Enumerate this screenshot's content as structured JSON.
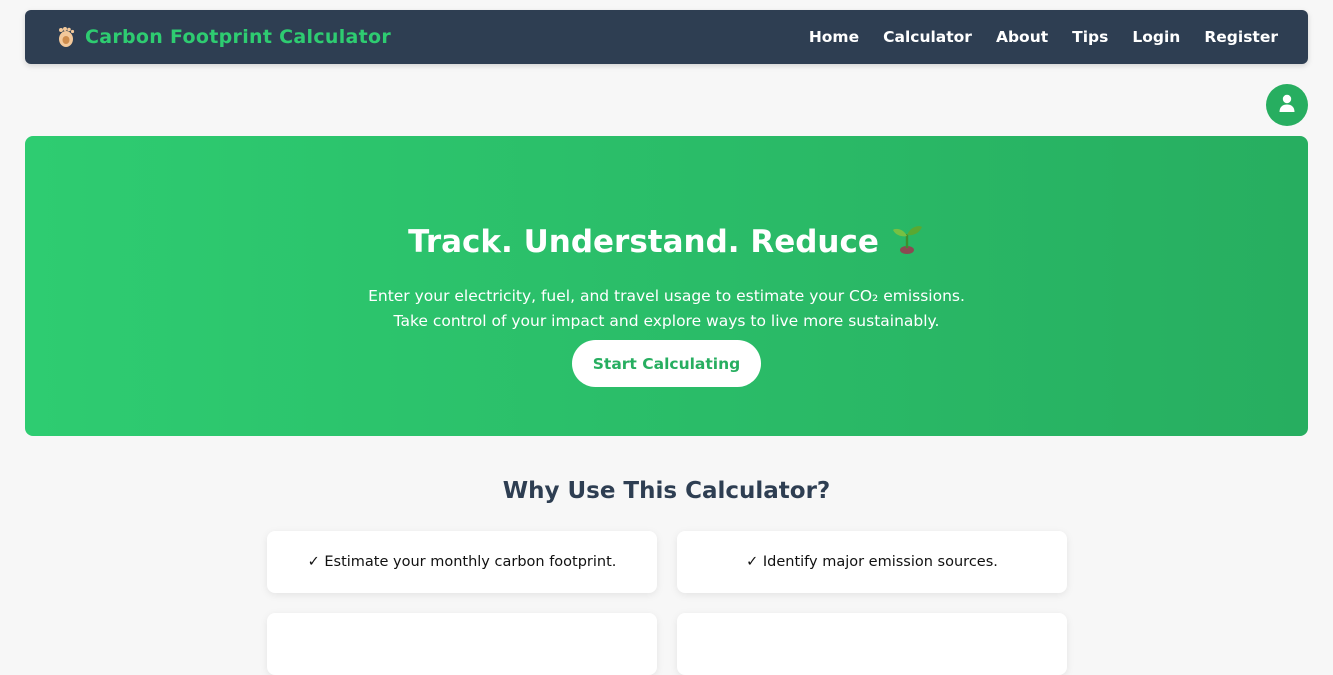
{
  "brand": {
    "title": "Carbon Footprint Calculator",
    "icon": "footprint-icon"
  },
  "nav": {
    "items": [
      {
        "label": "Home"
      },
      {
        "label": "Calculator"
      },
      {
        "label": "About"
      },
      {
        "label": "Tips"
      },
      {
        "label": "Login"
      },
      {
        "label": "Register"
      }
    ]
  },
  "user_button": {
    "icon": "user-icon"
  },
  "hero": {
    "title": "Track. Understand. Reduce",
    "title_emoji": "🌱",
    "line1": "Enter your electricity, fuel, and travel usage to estimate your CO₂ emissions.",
    "line2": "Take control of your impact and explore ways to live more sustainably.",
    "button": "Start Calculating"
  },
  "why": {
    "title": "Why Use This Calculator?",
    "features": [
      {
        "text": "✓ Estimate your monthly carbon footprint."
      },
      {
        "text": "✓ Identify major emission sources."
      },
      {
        "text": ""
      },
      {
        "text": ""
      }
    ]
  },
  "colors": {
    "nav_bg": "#2e3e52",
    "accent": "#2ecc71",
    "accent_dark": "#27ae60",
    "page_bg": "#f7f7f7"
  }
}
